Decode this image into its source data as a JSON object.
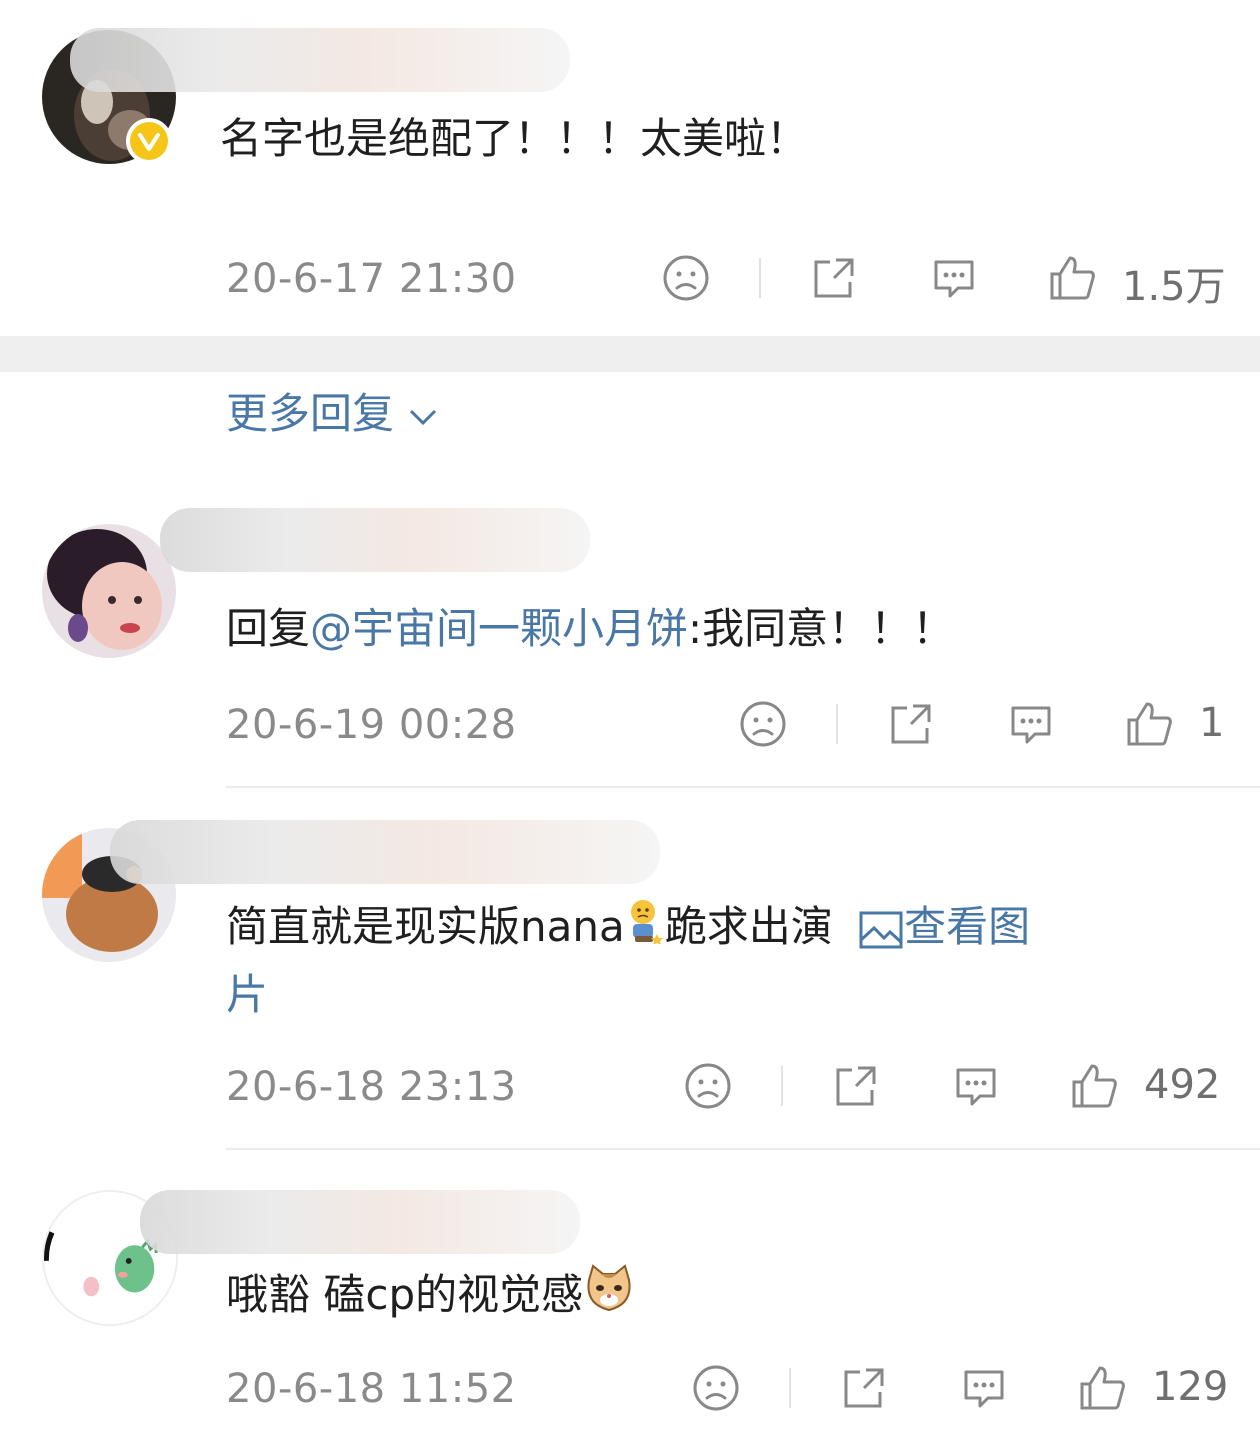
{
  "comments": [
    {
      "text": "名字也是绝配了！！！太美啦！",
      "time": "20-6-17 21:30",
      "likes": "1.5万",
      "verified": true
    },
    {
      "reply_prefix": "回复",
      "mention": "@宇宙间一颗小月饼",
      "reply_text": ":我同意！！！",
      "time": "20-6-19 00:28",
      "likes": "1"
    },
    {
      "text_main": "简直就是现实版nana",
      "text_after_emoji": "跪求出演",
      "link_text": "查看图",
      "link_text_wrap": "片",
      "time": "20-6-18 23:13",
      "likes": "492"
    },
    {
      "text": "哦豁 磕cp的视觉感",
      "time": "20-6-18 11:52",
      "likes": "129"
    }
  ],
  "more_replies": "更多回复",
  "icons": [
    "sad-face-icon",
    "share-icon",
    "comment-icon",
    "thumb-up-icon",
    "image-link-icon",
    "chevron-down-icon",
    "verified-badge-icon"
  ],
  "colors": {
    "link": "#4a78a6",
    "meta": "#8a8a8a",
    "badge": "#f5c518"
  }
}
